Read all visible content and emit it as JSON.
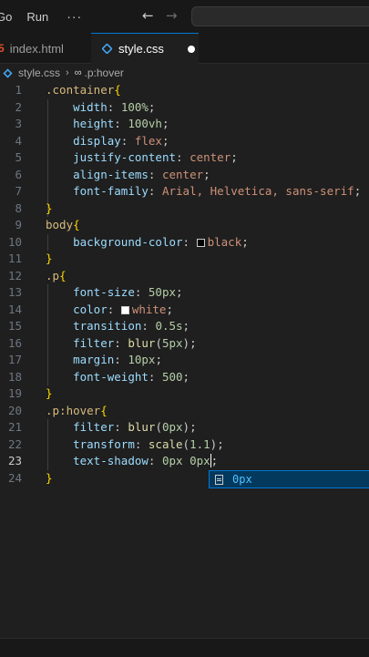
{
  "menu": {
    "go_label": "Go",
    "run_label": "Run",
    "more_label": "···"
  },
  "nav": {
    "back_icon": "arrow-left-icon",
    "forward_icon": "arrow-right-icon"
  },
  "tabs": [
    {
      "label": "index.html",
      "icon": "html-file-icon",
      "active": false
    },
    {
      "label": "style.css",
      "icon": "css-file-icon",
      "active": true,
      "unsaved": true
    }
  ],
  "breadcrumb": {
    "file": "style.css",
    "symbol": ".p:hover"
  },
  "editor": {
    "current_line": 23,
    "line_numbers": [
      "1",
      "2",
      "3",
      "4",
      "5",
      "6",
      "7",
      "8",
      "9",
      "10",
      "11",
      "12",
      "13",
      "14",
      "15",
      "16",
      "17",
      "18",
      "19",
      "20",
      "21",
      "22",
      "23",
      "24"
    ],
    "lines": [
      [
        {
          "t": ".container",
          "c": "sel"
        },
        {
          "t": "{",
          "c": "brace"
        }
      ],
      [
        {
          "t": "    "
        },
        {
          "t": "width",
          "c": "prop"
        },
        {
          "t": ": ",
          "c": "punc"
        },
        {
          "t": "100%",
          "c": "num"
        },
        {
          "t": ";",
          "c": "punc"
        }
      ],
      [
        {
          "t": "    "
        },
        {
          "t": "height",
          "c": "prop"
        },
        {
          "t": ": ",
          "c": "punc"
        },
        {
          "t": "100vh",
          "c": "num"
        },
        {
          "t": ";",
          "c": "punc"
        }
      ],
      [
        {
          "t": "    "
        },
        {
          "t": "display",
          "c": "prop"
        },
        {
          "t": ": ",
          "c": "punc"
        },
        {
          "t": "flex",
          "c": "val"
        },
        {
          "t": ";",
          "c": "punc"
        }
      ],
      [
        {
          "t": "    "
        },
        {
          "t": "justify-content",
          "c": "prop"
        },
        {
          "t": ": ",
          "c": "punc"
        },
        {
          "t": "center",
          "c": "val"
        },
        {
          "t": ";",
          "c": "punc"
        }
      ],
      [
        {
          "t": "    "
        },
        {
          "t": "align-items",
          "c": "prop"
        },
        {
          "t": ": ",
          "c": "punc"
        },
        {
          "t": "center",
          "c": "val"
        },
        {
          "t": ";",
          "c": "punc"
        }
      ],
      [
        {
          "t": "    "
        },
        {
          "t": "font-family",
          "c": "prop"
        },
        {
          "t": ": ",
          "c": "punc"
        },
        {
          "t": "Arial, Helvetica, sans-serif",
          "c": "val"
        },
        {
          "t": ";",
          "c": "punc"
        }
      ],
      [
        {
          "t": "}",
          "c": "brace"
        }
      ],
      [
        {
          "t": "body",
          "c": "tag"
        },
        {
          "t": "{",
          "c": "brace"
        }
      ],
      [
        {
          "t": "    "
        },
        {
          "t": "background-color",
          "c": "prop"
        },
        {
          "t": ": ",
          "c": "punc"
        },
        {
          "swatch": "#000000"
        },
        {
          "t": "black",
          "c": "val"
        },
        {
          "t": ";",
          "c": "punc"
        }
      ],
      [
        {
          "t": "}",
          "c": "brace"
        }
      ],
      [
        {
          "t": ".p",
          "c": "sel"
        },
        {
          "t": "{",
          "c": "brace"
        }
      ],
      [
        {
          "t": "    "
        },
        {
          "t": "font-size",
          "c": "prop"
        },
        {
          "t": ": ",
          "c": "punc"
        },
        {
          "t": "50px",
          "c": "num"
        },
        {
          "t": ";",
          "c": "punc"
        }
      ],
      [
        {
          "t": "    "
        },
        {
          "t": "color",
          "c": "prop"
        },
        {
          "t": ": ",
          "c": "punc"
        },
        {
          "swatch": "#ffffff"
        },
        {
          "t": "white",
          "c": "val"
        },
        {
          "t": ";",
          "c": "punc"
        }
      ],
      [
        {
          "t": "    "
        },
        {
          "t": "transition",
          "c": "prop"
        },
        {
          "t": ": ",
          "c": "punc"
        },
        {
          "t": "0.5s",
          "c": "num"
        },
        {
          "t": ";",
          "c": "punc"
        }
      ],
      [
        {
          "t": "    "
        },
        {
          "t": "filter",
          "c": "prop"
        },
        {
          "t": ": ",
          "c": "punc"
        },
        {
          "t": "blur",
          "c": "fn"
        },
        {
          "t": "(",
          "c": "punc"
        },
        {
          "t": "5px",
          "c": "num"
        },
        {
          "t": ")",
          "c": "punc"
        },
        {
          "t": ";",
          "c": "punc"
        }
      ],
      [
        {
          "t": "    "
        },
        {
          "t": "margin",
          "c": "prop"
        },
        {
          "t": ": ",
          "c": "punc"
        },
        {
          "t": "10px",
          "c": "num"
        },
        {
          "t": ";",
          "c": "punc"
        }
      ],
      [
        {
          "t": "    "
        },
        {
          "t": "font-weight",
          "c": "prop"
        },
        {
          "t": ": ",
          "c": "punc"
        },
        {
          "t": "500",
          "c": "num"
        },
        {
          "t": ";",
          "c": "punc"
        }
      ],
      [
        {
          "t": "}",
          "c": "brace"
        }
      ],
      [
        {
          "t": ".p:hover",
          "c": "sel"
        },
        {
          "t": "{",
          "c": "brace"
        }
      ],
      [
        {
          "t": "    "
        },
        {
          "t": "filter",
          "c": "prop"
        },
        {
          "t": ": ",
          "c": "punc"
        },
        {
          "t": "blur",
          "c": "fn"
        },
        {
          "t": "(",
          "c": "punc"
        },
        {
          "t": "0px",
          "c": "num"
        },
        {
          "t": ")",
          "c": "punc"
        },
        {
          "t": ";",
          "c": "punc"
        }
      ],
      [
        {
          "t": "    "
        },
        {
          "t": "transform",
          "c": "prop"
        },
        {
          "t": ": ",
          "c": "punc"
        },
        {
          "t": "scale",
          "c": "fn"
        },
        {
          "t": "(",
          "c": "punc"
        },
        {
          "t": "1.1",
          "c": "num"
        },
        {
          "t": ")",
          "c": "punc"
        },
        {
          "t": ";",
          "c": "punc"
        }
      ],
      [
        {
          "t": "    "
        },
        {
          "t": "text-shadow",
          "c": "prop"
        },
        {
          "t": ": ",
          "c": "punc"
        },
        {
          "t": "0px 0px",
          "c": "num"
        },
        {
          "cursor": true
        },
        {
          "t": ";",
          "c": "punc"
        }
      ],
      [
        {
          "t": "}",
          "c": "brace"
        }
      ]
    ]
  },
  "suggestion": {
    "icon": "unit-icon",
    "label": "0px"
  },
  "colors": {
    "selector": "#d7ba7d",
    "property": "#9cdcfe",
    "value": "#ce9178",
    "number": "#b5cea8",
    "function": "#dcdcaa",
    "brace": "#ffd700",
    "accent": "#0078d4"
  }
}
